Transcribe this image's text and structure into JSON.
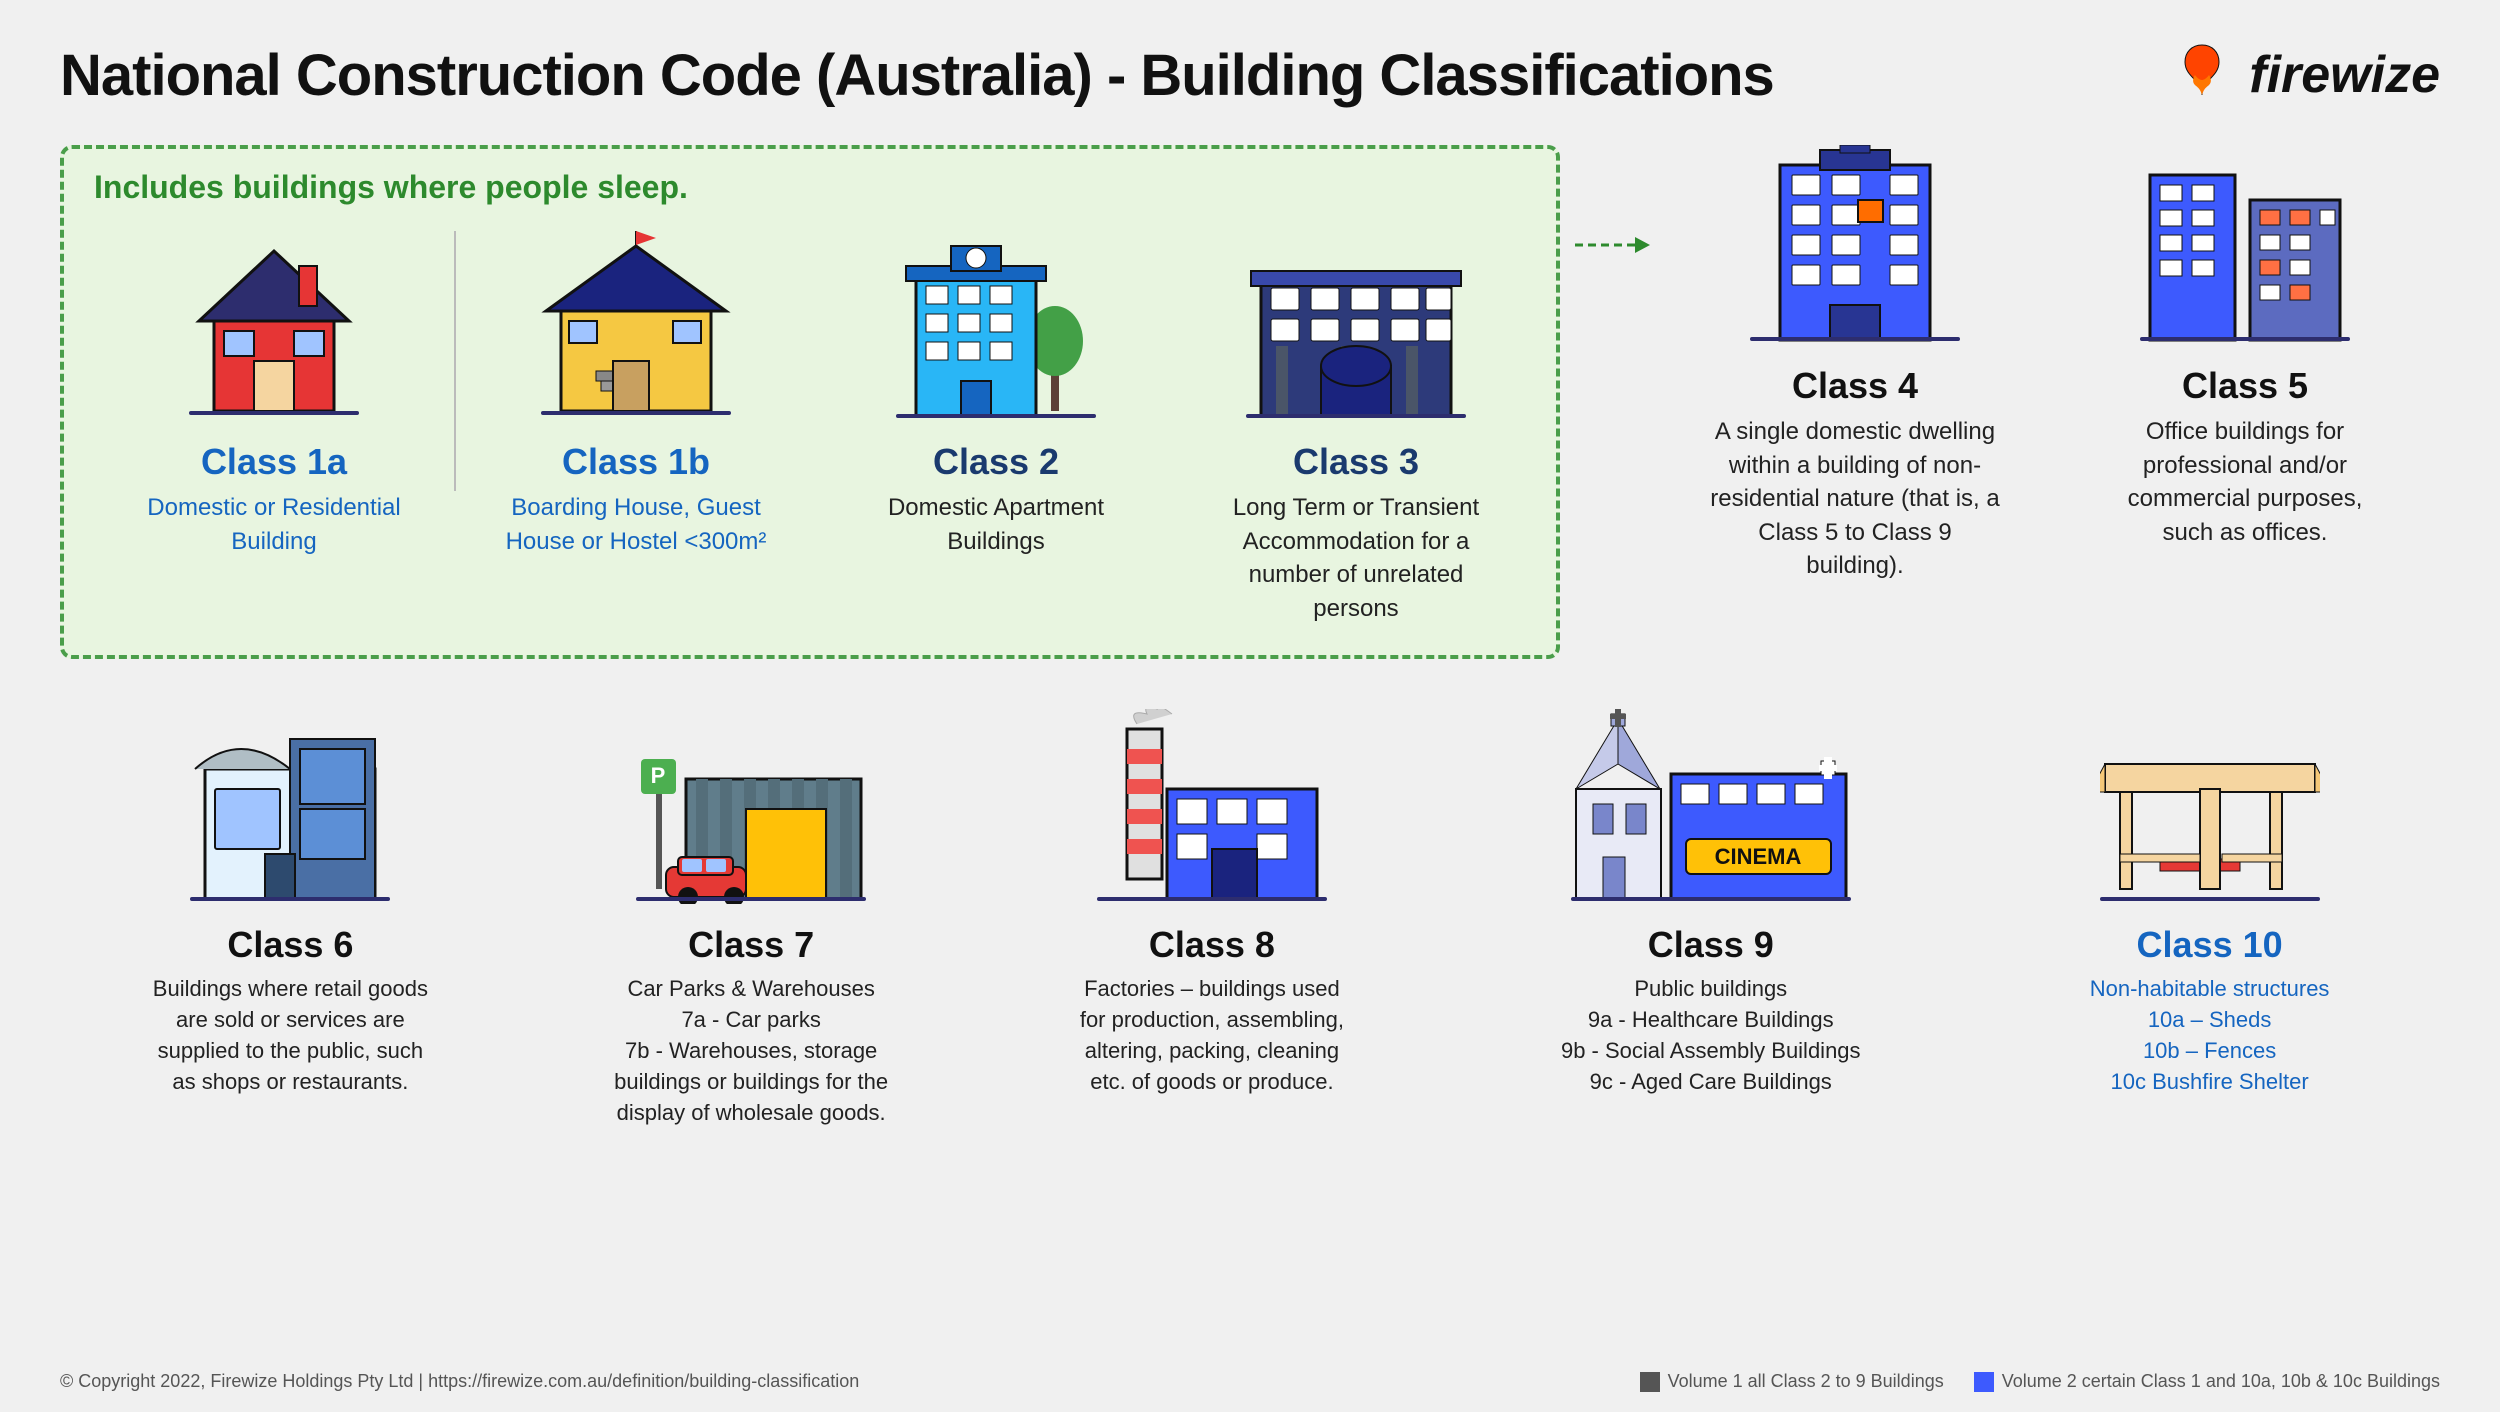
{
  "title": "National Construction Code (Australia) - Building Classifications",
  "logo": {
    "text": "firewize"
  },
  "green_box_label": "Includes buildings where people sleep.",
  "classes": [
    {
      "id": "class1a",
      "label": "Class 1a",
      "desc": "Domestic or Residential Building",
      "is_blue": true,
      "color": "#1565c0"
    },
    {
      "id": "class1b",
      "label": "Class 1b",
      "desc": "Boarding House, Guest House or Hostel <300m²",
      "is_blue": true,
      "color": "#1565c0"
    },
    {
      "id": "class2",
      "label": "Class 2",
      "desc": "Domestic Apartment Buildings",
      "is_blue": false,
      "color": "#111"
    },
    {
      "id": "class3",
      "label": "Class 3",
      "desc": "Long Term or Transient Accommodation for a number of unrelated persons",
      "is_blue": false,
      "color": "#111"
    },
    {
      "id": "class4",
      "label": "Class 4",
      "desc": "A single domestic dwelling within a building of non-residential nature (that is, a Class 5 to Class 9 building).",
      "is_blue": false,
      "color": "#111"
    },
    {
      "id": "class5",
      "label": "Class 5",
      "desc": "Office buildings for professional and/or commercial purposes, such as offices.",
      "is_blue": false,
      "color": "#111"
    },
    {
      "id": "class6",
      "label": "Class 6",
      "desc": "Buildings where retail goods are sold or services are supplied to the public, such as shops or restaurants.",
      "is_blue": false,
      "color": "#111"
    },
    {
      "id": "class7",
      "label": "Class 7",
      "desc": "Car Parks & Warehouses\n7a - Car parks\n7b - Warehouses, storage buildings or buildings for the display of wholesale goods.",
      "is_blue": false,
      "color": "#111"
    },
    {
      "id": "class8",
      "label": "Class 8",
      "desc": "Factories – buildings used for production, assembling, altering, packing, cleaning etc. of goods or produce.",
      "is_blue": false,
      "color": "#111"
    },
    {
      "id": "class9",
      "label": "Class 9",
      "desc": "Public buildings\n9a - Healthcare Buildings\n9b - Social Assembly Buildings\n9c - Aged Care Buildings",
      "is_blue": false,
      "color": "#111"
    },
    {
      "id": "class10",
      "label": "Class 10",
      "desc": "Non-habitable structures\n10a – Sheds\n10b – Fences\n10c Bushfire Shelter",
      "is_blue": true,
      "color": "#1565c0"
    }
  ],
  "footer": {
    "copyright": "© Copyright 2022, Firewize Holdings Pty Ltd   |   https://firewize.com.au/definition/building-classification",
    "legend1": "Volume 1 all Class 2 to 9 Buildings",
    "legend2": "Volume 2 certain Class 1 and 10a, 10b & 10c Buildings"
  }
}
